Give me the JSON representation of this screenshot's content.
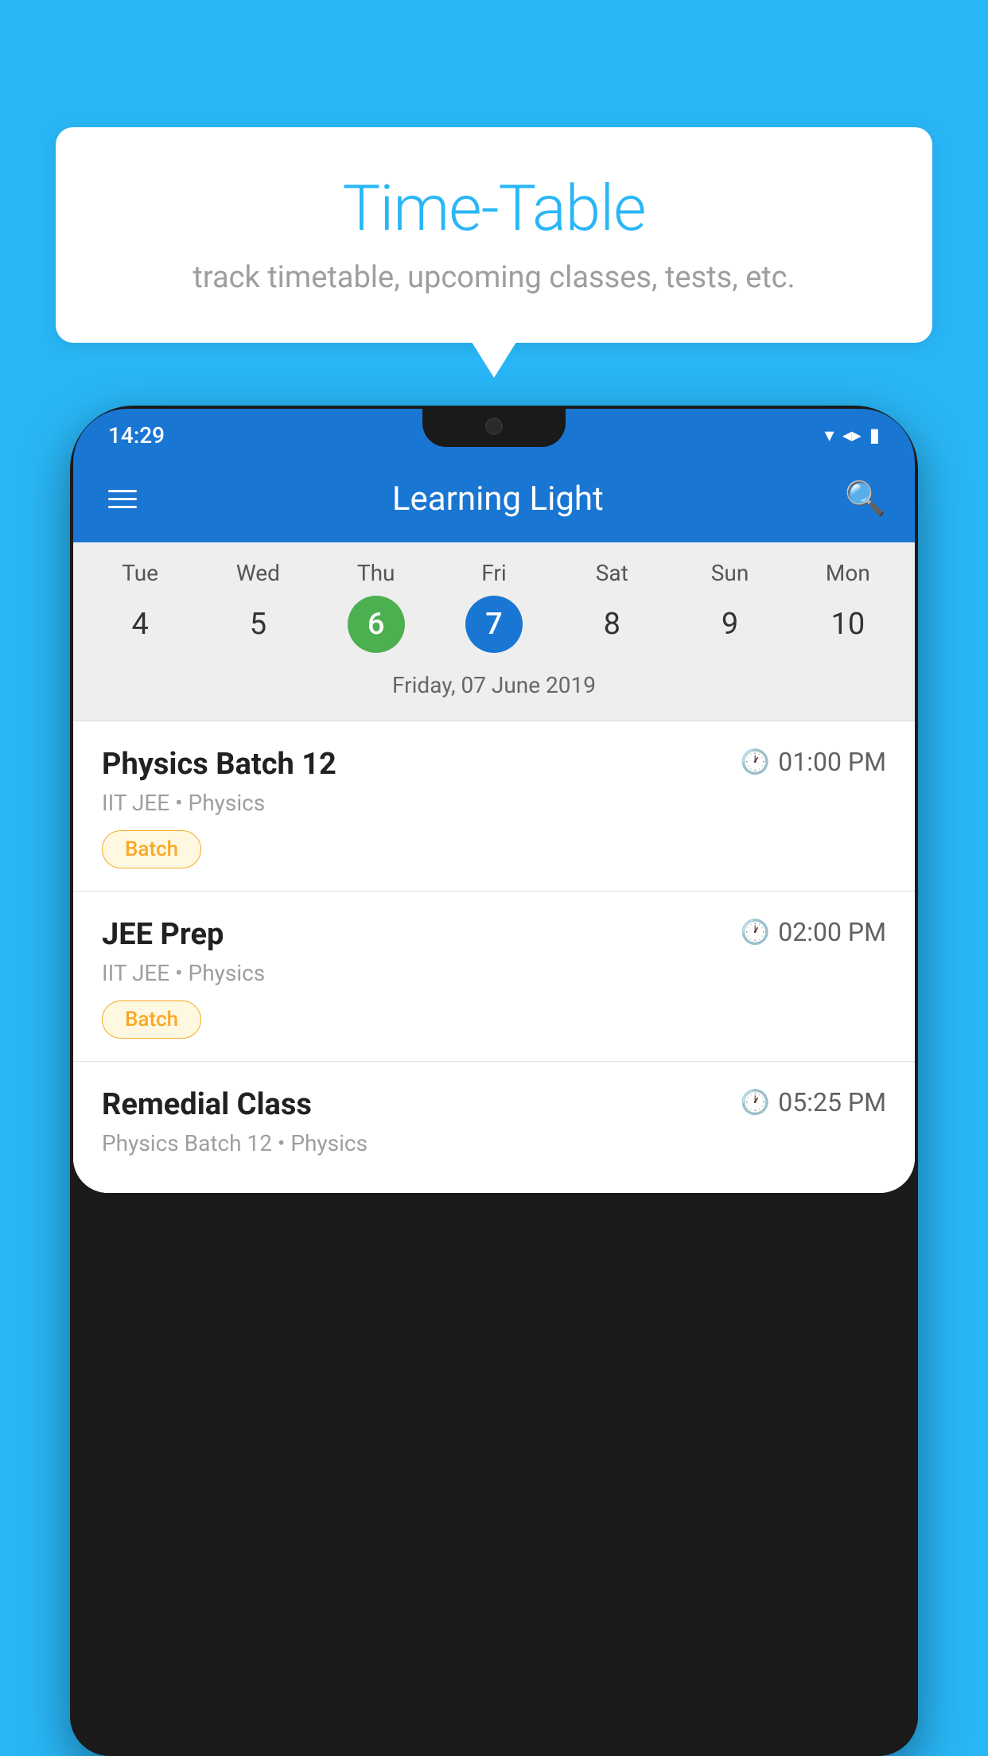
{
  "background_color": "#29B6F6",
  "speech_bubble": {
    "title": "Time-Table",
    "subtitle": "track timetable, upcoming classes, tests, etc."
  },
  "status_bar": {
    "time": "14:29"
  },
  "app_bar": {
    "title": "Learning Light",
    "hamburger_label": "menu",
    "search_label": "search"
  },
  "calendar": {
    "days": [
      {
        "label": "Tue",
        "number": "4"
      },
      {
        "label": "Wed",
        "number": "5"
      },
      {
        "label": "Thu",
        "number": "6",
        "state": "today"
      },
      {
        "label": "Fri",
        "number": "7",
        "state": "selected"
      },
      {
        "label": "Sat",
        "number": "8"
      },
      {
        "label": "Sun",
        "number": "9"
      },
      {
        "label": "Mon",
        "number": "10"
      }
    ],
    "selected_date": "Friday, 07 June 2019"
  },
  "schedule": {
    "items": [
      {
        "title": "Physics Batch 12",
        "time": "01:00 PM",
        "subtitle": "IIT JEE • Physics",
        "badge": "Batch"
      },
      {
        "title": "JEE Prep",
        "time": "02:00 PM",
        "subtitle": "IIT JEE • Physics",
        "badge": "Batch"
      },
      {
        "title": "Remedial Class",
        "time": "05:25 PM",
        "subtitle": "Physics Batch 12 • Physics",
        "badge": ""
      }
    ]
  }
}
